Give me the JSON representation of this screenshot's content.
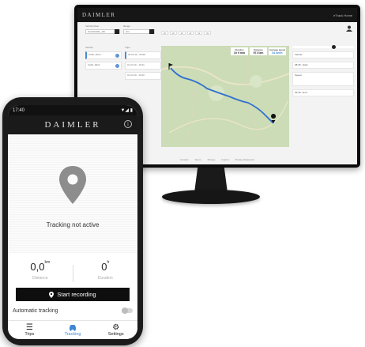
{
  "desktop": {
    "brand": "DAIMLER",
    "user": "eTrack Home",
    "filters": [
      {
        "label": "Vehicle Fleet",
        "value": "SCHENDEL_DE"
      },
      {
        "label": "Range",
        "value": "dist"
      }
    ],
    "chips": [
      "W",
      "W",
      "W",
      "W",
      "W",
      "W",
      "W",
      "W"
    ],
    "list_left": [
      "Vehicle",
      "KARL-2010",
      "KARL-0022"
    ],
    "list_right": [
      "Trips",
      "28.06.19 - 09:58",
      "01.03.19 - 16:31",
      "01.03.19 - 16:20"
    ],
    "stats": [
      {
        "label": "Duration",
        "value": "1h 9 min"
      },
      {
        "label": "Distance",
        "value": "97.5 km"
      },
      {
        "label": "Average speed",
        "value": "81 km/h"
      }
    ],
    "details": [
      {
        "label": "Vehicle",
        "value": ""
      },
      {
        "label": "08:38 - Start",
        "value": ""
      },
      {
        "label": "Speed",
        "value": ""
      },
      {
        "label": "09:48 - End",
        "value": ""
      }
    ],
    "footer_links": [
      "Contact",
      "Terms",
      "Privacy",
      "Imprint",
      "Privacy Statement"
    ]
  },
  "phone": {
    "time": "17:40",
    "signal": "▼◢ ▮",
    "brand": "DAIMLER",
    "info_icon": "info-icon",
    "tracking_status": "Tracking not active",
    "distance_value": "0,0",
    "distance_unit": "km",
    "distance_label": "Distance",
    "duration_value": "0",
    "duration_unit": "h",
    "duration_label": "Duration",
    "record_label": "Start recording",
    "auto_label": "Automatic tracking",
    "tabs": [
      {
        "label": "Trips",
        "icon": "list-icon"
      },
      {
        "label": "Tracking",
        "icon": "car-icon"
      },
      {
        "label": "Settings",
        "icon": "gear-icon"
      }
    ],
    "accent": "#3f86d6"
  }
}
